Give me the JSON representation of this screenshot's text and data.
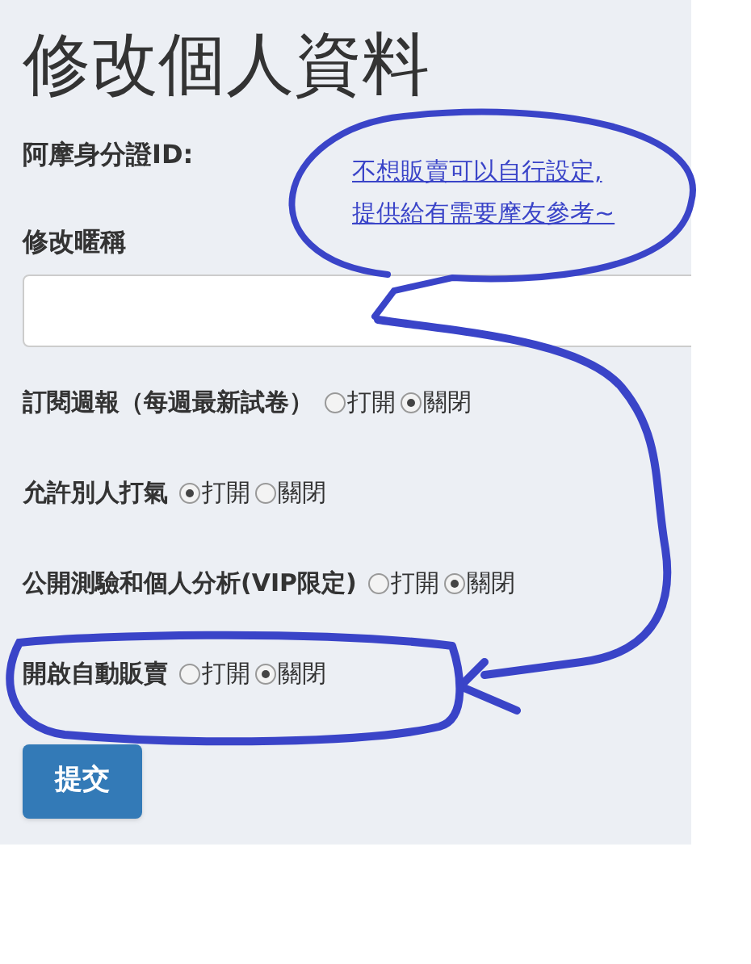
{
  "title": "修改個人資料",
  "id_label": "阿摩身分證ID:",
  "nickname": {
    "label": "修改暱稱"
  },
  "settings": [
    {
      "label": "訂閱週報（每週最新試卷）",
      "options": [
        {
          "label": "打開",
          "selected": false
        },
        {
          "label": "關閉",
          "selected": true
        }
      ]
    },
    {
      "label": "允許別人打氣",
      "options": [
        {
          "label": "打開",
          "selected": true
        },
        {
          "label": "關閉",
          "selected": false
        }
      ]
    },
    {
      "label": "公開測驗和個人分析(VIP限定)",
      "options": [
        {
          "label": "打開",
          "selected": false
        },
        {
          "label": "關閉",
          "selected": true
        }
      ]
    },
    {
      "label": "開啟自動販賣",
      "options": [
        {
          "label": "打開",
          "selected": false
        },
        {
          "label": "關閉",
          "selected": true
        }
      ]
    }
  ],
  "submit": "提交",
  "annotation": [
    "不想販賣可以自行設定,",
    "提供給有需要摩友參考~"
  ]
}
